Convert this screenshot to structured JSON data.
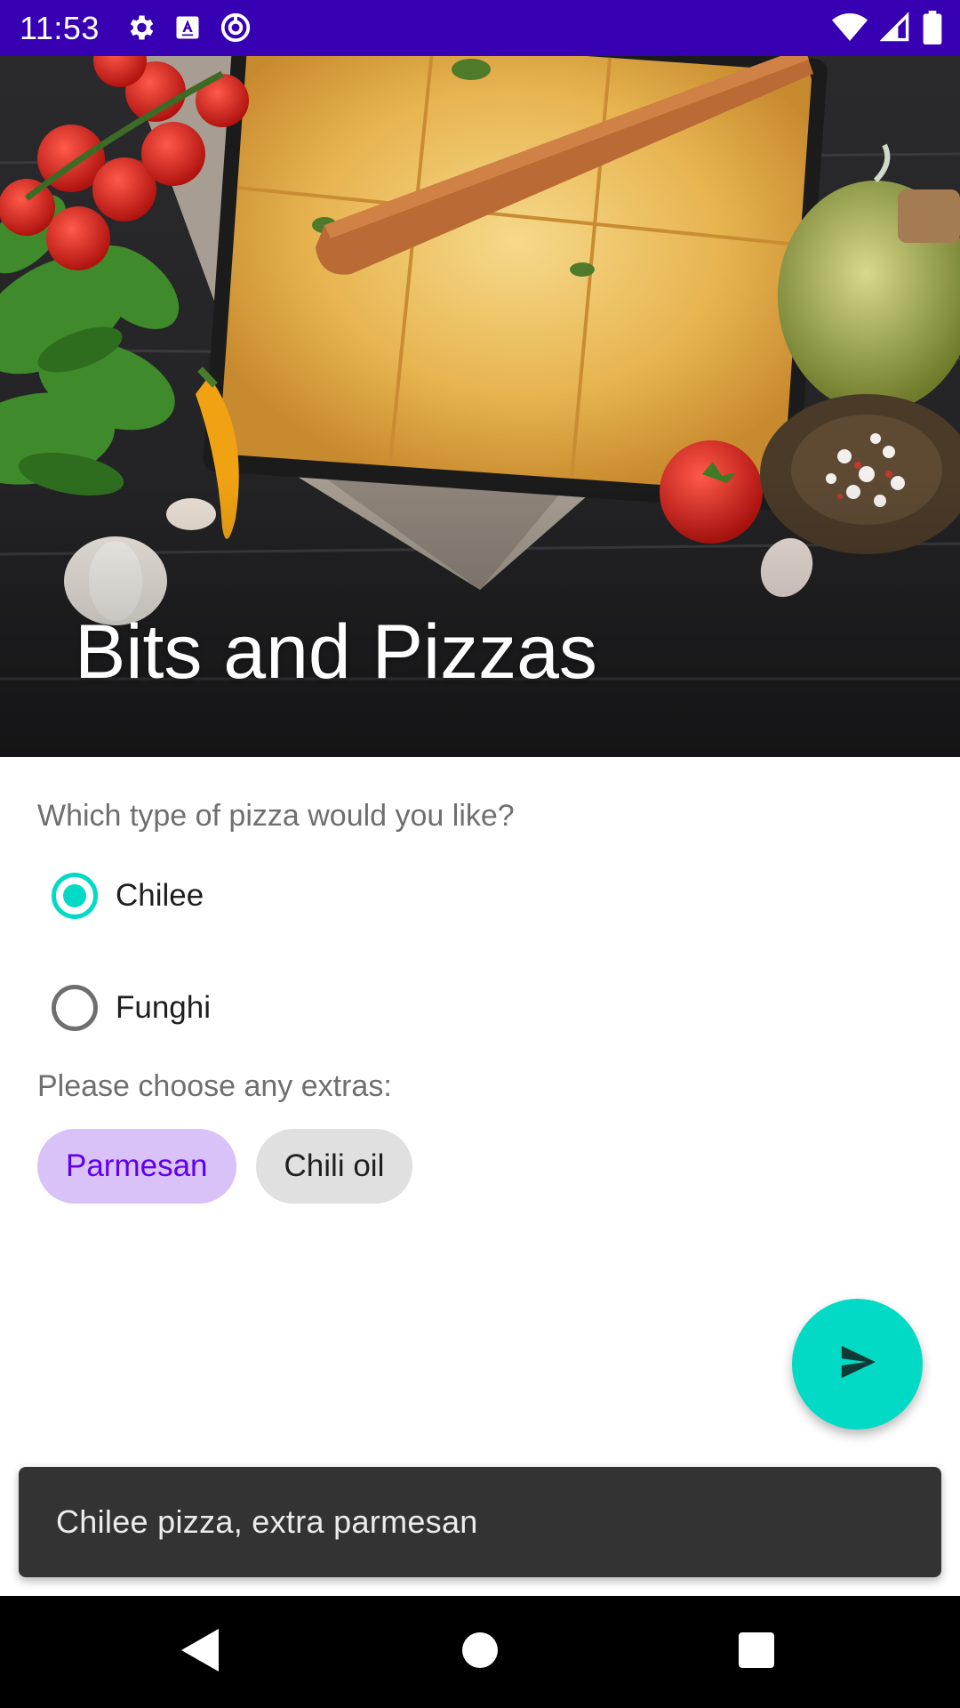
{
  "status_bar": {
    "time": "11:53",
    "left_icons": [
      "settings-icon",
      "keyboard-a-icon",
      "data-saver-icon"
    ],
    "right_icons": [
      "wifi-icon",
      "signal-icon",
      "battery-icon"
    ],
    "background": "#3700b3"
  },
  "hero": {
    "title": "Bits and Pizzas",
    "image": "pizza-tray-with-tomatoes-basil-garlic-oil"
  },
  "form": {
    "question": "Which type of pizza would you like?",
    "pizza_options": [
      {
        "label": "Chilee",
        "checked": true
      },
      {
        "label": "Funghi",
        "checked": false
      }
    ],
    "extras_label": "Please choose any extras:",
    "extras": [
      {
        "label": "Parmesan",
        "checked": true
      },
      {
        "label": "Chili oil",
        "checked": false
      }
    ]
  },
  "fab": {
    "icon": "send-icon",
    "color": "#03dac5"
  },
  "snackbar": {
    "text": "Chilee pizza, extra parmesan"
  },
  "nav_bar": {
    "buttons": [
      "back-icon",
      "home-icon",
      "recents-icon"
    ]
  },
  "colors": {
    "primary_dark": "#3700b3",
    "accent": "#03dac5",
    "chip_checked_text": "#6200ee",
    "chip_checked_bg": "#d8c2f7"
  }
}
